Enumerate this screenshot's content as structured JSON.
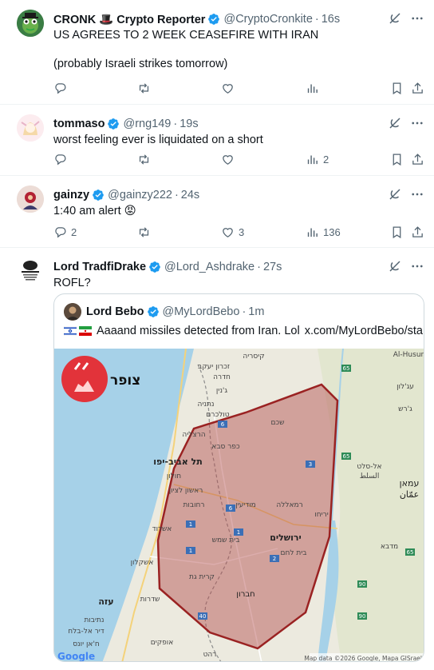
{
  "tweets": [
    {
      "name": "CRONK 🎩 Crypto Reporter",
      "handle": "@CryptoCronkite",
      "time": "16s",
      "text_line1": "US AGREES TO 2 WEEK CEASEFIRE WITH IRAN",
      "text_line2": "(probably Israeli strikes tomorrow)",
      "replies": "",
      "reposts": "",
      "likes": "",
      "views": ""
    },
    {
      "name": "tommaso",
      "handle": "@rng149",
      "time": "19s",
      "text_line1": "worst feeling ever is liquidated on a short",
      "replies": "",
      "reposts": "",
      "likes": "",
      "views": "2"
    },
    {
      "name": "gainzy",
      "handle": "@gainzy222",
      "time": "24s",
      "text_line1": "1:40 am alert 😡",
      "replies": "2",
      "reposts": "",
      "likes": "3",
      "views": "136"
    },
    {
      "name": "Lord TradfiDrake",
      "handle": "@Lord_Ashdrake",
      "time": "27s",
      "text_line1": "ROFL?",
      "quote": {
        "name": "Lord Bebo",
        "handle": "@MyLordBebo",
        "time": "1m",
        "text": "Aaaand missiles detected from Iran. Lol",
        "link": "x.com/MyLordBebo/sta...",
        "map": {
          "brand": "צופר",
          "attribution": "Map data ©2026 Google, Mapa GISrael",
          "google": "Google",
          "labels": {
            "tel_aviv": "תל אביב-יפו",
            "jerusalem": "ירושלים",
            "gaza": "עזה",
            "amman": "عمّان",
            "amman_he": "עמאן",
            "hebron": "חברון",
            "ashdod": "אשדוד",
            "rishon": "ראשון לציון",
            "holon": "חולון",
            "netanya": "נתניה",
            "herzliya": "הרצליה",
            "shechem": "שכם",
            "ramallah": "רמאללה",
            "jericho": "יריחו",
            "beit_shemesh": "בית שמש",
            "beit_lehem": "בית לחם",
            "rehovot": "רחובות",
            "ashkelon": "אשקלון",
            "kiryat_gat": "קרית גת",
            "modiin": "מודיעין",
            "caesarea": "קיסריה",
            "hadera": "חדרה",
            "al_husun": "Al-Husun",
            "al_salt": "السلط",
            "salt_he": "אל-סלט",
            "ajloun": "עג'לון",
            "jerash": "ג'רש",
            "madaba": "מדבא",
            "sderot": "שדרות",
            "netivot": "נתיבות",
            "ofakim": "אופקים",
            "rahat": "רהט",
            "dir_al_balah": "דיר אל-בלח",
            "khan_yunis": "ח'אן יונס",
            "zikhron": "זכרון יעקב",
            "tulkarm": "טולכרם",
            "kfar_saba": "כפר סבא",
            "jenin": "ג'נין"
          },
          "road_shields": [
            "65",
            "65",
            "65",
            "6",
            "6",
            "1",
            "1",
            "1",
            "40",
            "90",
            "90",
            "3",
            "2"
          ]
        }
      }
    }
  ]
}
